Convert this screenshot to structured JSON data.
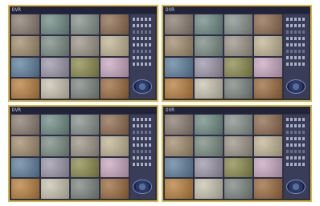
{
  "panels": [
    {
      "title": "DVR",
      "cam_colors": [
        "#8a7c70",
        "#6f8a84",
        "#85908a",
        "#8e6a4e",
        "#a38c6d",
        "#7a8a82",
        "#9c9488",
        "#c2b494",
        "#5f7f9c",
        "#9c97a9",
        "#8a8a4c",
        "#c9a8c0",
        "#b87e3c",
        "#c9c4b0",
        "#7c8680",
        "#9a6a3e"
      ]
    },
    {
      "title": "DVR",
      "cam_colors": [
        "#8a7c70",
        "#6f8a84",
        "#85908a",
        "#8e6a4e",
        "#a38c6d",
        "#7a8a82",
        "#9c9488",
        "#c2b494",
        "#5f7f9c",
        "#9c97a9",
        "#8a8a4c",
        "#c9a8c0",
        "#b87e3c",
        "#c9c4b0",
        "#7c8680",
        "#9a6a3e"
      ]
    },
    {
      "title": "DVR",
      "cam_colors": [
        "#8a7c70",
        "#6f8a84",
        "#85908a",
        "#8e6a4e",
        "#a38c6d",
        "#7a8a82",
        "#9c9488",
        "#c2b494",
        "#5f7f9c",
        "#9c97a9",
        "#8a8a4c",
        "#c9a8c0",
        "#b87e3c",
        "#c9c4b0",
        "#7c8680",
        "#9a6a3e"
      ]
    },
    {
      "title": "DVR",
      "cam_colors": [
        "#8a7c70",
        "#6f8a84",
        "#85908a",
        "#8e6a4e",
        "#a38c6d",
        "#7a8a82",
        "#9c9488",
        "#c2b494",
        "#5f7f9c",
        "#9c97a9",
        "#8a8a4c",
        "#c9a8c0",
        "#b87e3c",
        "#c9c4b0",
        "#7c8680",
        "#9a6a3e"
      ]
    }
  ],
  "colors": {
    "border": "#d9b545",
    "panel_bg": "#2e3146"
  }
}
